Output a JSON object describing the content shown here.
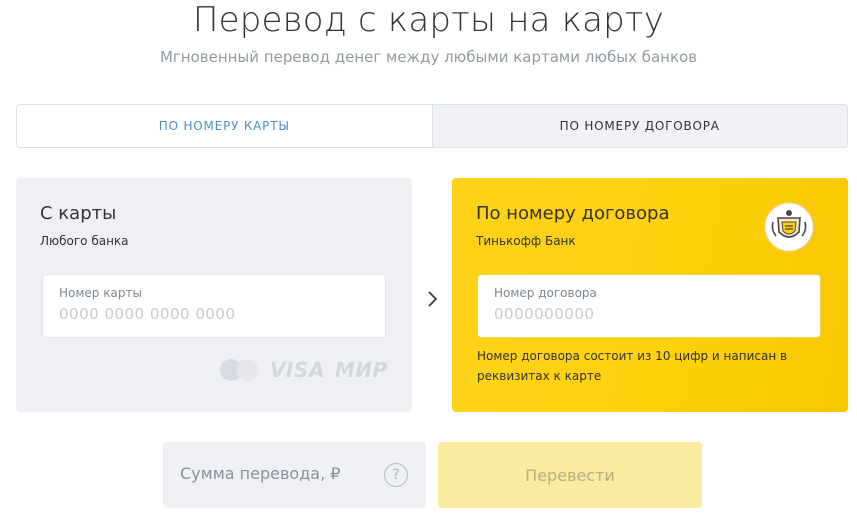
{
  "header": {
    "title": "Перевод с карты на карту",
    "subtitle": "Мгновенный перевод денег между любыми картами любых банков"
  },
  "tabs": [
    {
      "label": "ПО НОМЕРУ КАРТЫ",
      "active": false
    },
    {
      "label": "ПО НОМЕРУ ДОГОВОРА",
      "active": true
    }
  ],
  "from_card": {
    "title": "С карты",
    "subtitle": "Любого банка",
    "field_label": "Номер карты",
    "field_placeholder": "0000 0000 0000 0000",
    "logos": {
      "mastercard": "mastercard-icon",
      "visa": "VISA",
      "mir": "МИР"
    }
  },
  "to_card": {
    "title": "По номеру договора",
    "subtitle": "Тинькофф Банк",
    "field_label": "Номер договора",
    "field_placeholder": "0000000000",
    "hint": "Номер договора состоит из 10 цифр и написан в реквизитах к карте",
    "logo_icon": "tinkoff-bank-crest-icon"
  },
  "amount": {
    "placeholder": "Сумма перевода, ₽",
    "help_icon": "?"
  },
  "submit": {
    "label": "Перевести"
  },
  "colors": {
    "accent_yellow": "#ffd31a",
    "card_gray": "#eef0f4",
    "tab_link": "#4a90c8",
    "button_disabled": "#fbeb9e"
  }
}
